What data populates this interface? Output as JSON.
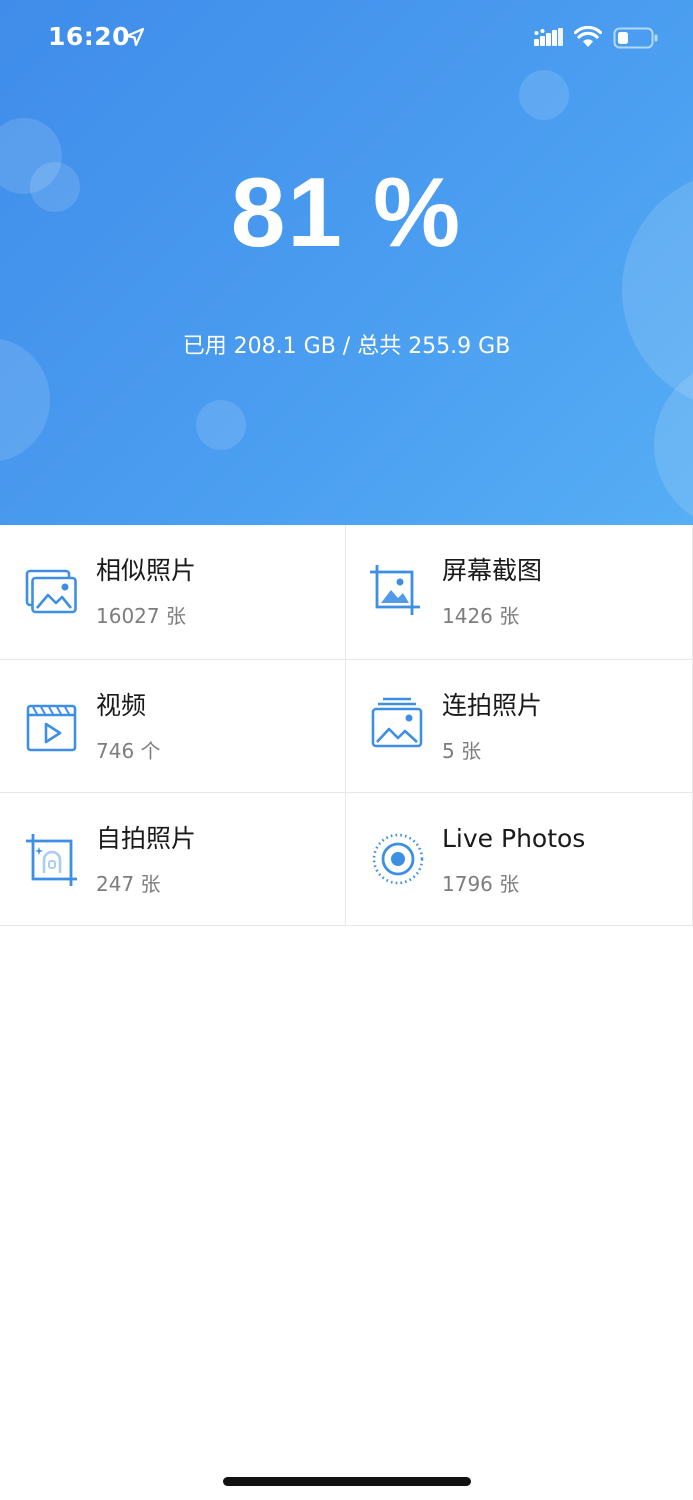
{
  "status_bar": {
    "time": "16:20"
  },
  "storage": {
    "percent": "81 %",
    "usage_text": "已用 208.1 GB / 总共 255.9 GB"
  },
  "categories": [
    {
      "title": "相似照片",
      "count": "16027 张",
      "icon": "similar-photos-icon"
    },
    {
      "title": "屏幕截图",
      "count": "1426 张",
      "icon": "screenshot-icon"
    },
    {
      "title": "视频",
      "count": "746 个",
      "icon": "video-icon"
    },
    {
      "title": "连拍照片",
      "count": "5 张",
      "icon": "burst-photos-icon"
    },
    {
      "title": "自拍照片",
      "count": "247 张",
      "icon": "selfie-icon"
    },
    {
      "title": "Live Photos",
      "count": "1796 张",
      "icon": "live-photos-icon"
    }
  ],
  "colors": {
    "header_start": "#3f8cea",
    "header_end": "#56aef4",
    "icon_blue": "#3d8fe6"
  }
}
